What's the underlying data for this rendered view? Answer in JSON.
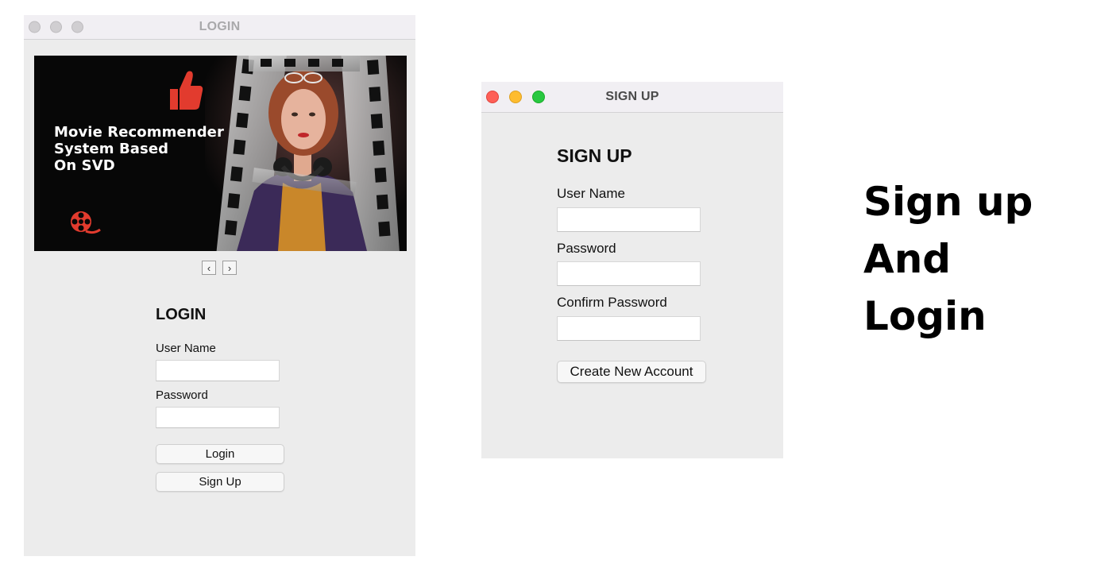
{
  "login_window": {
    "title": "LOGIN",
    "banner": {
      "lines": [
        "Movie Recommender",
        "System Based",
        "On SVD"
      ]
    },
    "nav": {
      "prev_icon": "chevron-left-icon",
      "next_icon": "chevron-right-icon",
      "prev_glyph": "‹",
      "next_glyph": "›"
    },
    "heading": "LOGIN",
    "username_label": "User Name",
    "username_value": "",
    "password_label": "Password",
    "password_value": "",
    "login_button": "Login",
    "signup_button": "Sign Up"
  },
  "signup_window": {
    "title": "SIGN UP",
    "heading": "SIGN UP",
    "username_label": "User Name",
    "username_value": "",
    "password_label": "Password",
    "password_value": "",
    "confirm_label": "Confirm Password",
    "confirm_value": "",
    "create_button": "Create New Account"
  },
  "caption": {
    "lines": [
      "Sign up",
      "And",
      "Login"
    ]
  },
  "colors": {
    "window_bg": "#ececec",
    "titlebar_bg": "#f1eff3",
    "close": "#fe5f57",
    "minimize": "#febc2e",
    "maximize": "#28c840",
    "accent_red": "#e23b2e"
  }
}
